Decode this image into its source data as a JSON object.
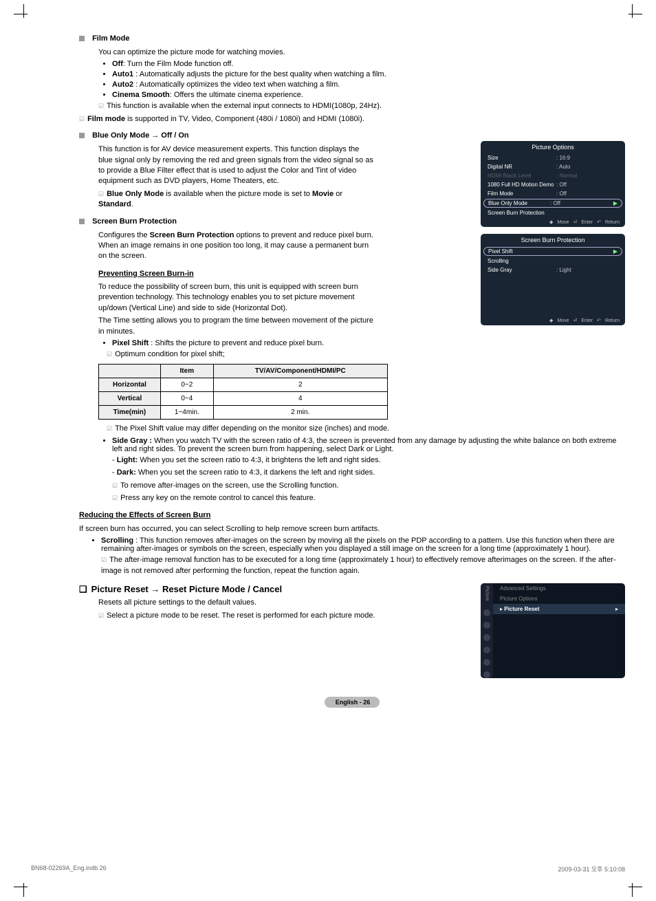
{
  "film_mode": {
    "title": "Film Mode",
    "desc": "You can optimize the picture mode for watching movies.",
    "off_label": "Off",
    "off_text": ": Turn the Film Mode function off.",
    "auto1_label": "Auto1",
    "auto1_text": " : Automatically adjusts the picture for the best quality when watching a film.",
    "auto2_label": "Auto2",
    "auto2_text": " : Automatically optimizes the video text when watching a film.",
    "cinema_label": "Cinema Smooth",
    "cinema_text": ": Offers the ultimate cinema experience.",
    "note1": "This function is available when the external input connects to HDMI(1080p, 24Hz).",
    "note2_a": "Film mode",
    "note2_b": " is supported in TV, Video, Component (480i / 1080i)  and HDMI (1080i)."
  },
  "blue_only": {
    "title": "Blue Only Mode → Off / On",
    "desc": "This function is for AV device measurement experts. This function displays the blue signal only by removing the red and green signals from the video signal so as to provide a Blue Filter effect that is used to adjust the Color and Tint of video equipment such as DVD players, Home Theaters, etc.",
    "note_a": "Blue Only Mode",
    "note_b": " is available when the picture mode is set to ",
    "note_c": "Movie",
    "note_d": " or ",
    "note_e": "Standard",
    "note_f": "."
  },
  "screen_burn": {
    "title": "Screen Burn Protection",
    "desc1": "Configures the ",
    "desc1b": "Screen Burn Protection",
    "desc1c": " options to prevent and reduce pixel burn. When an image remains in one position too long, it may cause a permanent burn on the screen.",
    "prevent_heading": "Preventing Screen Burn-in",
    "prevent_p1": "To reduce the possibility of screen burn, this unit is equipped with screen burn prevention technology. This technology enables you to set picture movement up/down (Vertical Line) and side to side (Horizontal Dot).",
    "prevent_p2": "The Time setting allows you to program the time between movement of the picture in minutes.",
    "pixel_shift_label": "Pixel Shift",
    "pixel_shift_text": " : Shifts the picture to prevent and reduce pixel burn.",
    "pixel_note": "Optimum condition for pixel shift;",
    "table": {
      "h1": "Item",
      "h2": "TV/AV/Component/HDMI/PC",
      "r1a": "Horizontal",
      "r1b": "0~2",
      "r1c": "2",
      "r2a": "Vertical",
      "r2b": "0~4",
      "r2c": "4",
      "r3a": "Time(min)",
      "r3b": "1~4min.",
      "r3c": "2 min."
    },
    "pixel_note2": "The Pixel Shift value may differ depending on the monitor size (inches) and mode.",
    "side_gray_label": "Side Gray :",
    "side_gray_text": " When you watch TV with the screen ratio of 4:3, the screen is prevented from any damage by adjusting the white balance on both extreme left and right sides. To prevent the screen burn from happening, select Dark or Light.",
    "light_label": "Light:",
    "light_text": " When you set the screen ratio to 4:3, it brightens the left and right sides.",
    "dark_label": "Dark:",
    "dark_text": " When you set the screen ratio to 4:3, it darkens the left and right sides.",
    "note3": "To remove after-images on the screen, use the Scrolling function.",
    "note4": "Press any key on the remote control to cancel this feature.",
    "reduce_heading": "Reducing the Effects of Screen Burn",
    "reduce_p": "If screen burn has occurred, you can select Scrolling to help remove screen burn artifacts.",
    "scroll_label": "Scrolling",
    "scroll_text": " : This function removes after-images on the screen by moving all the pixels on the PDP according to a pattern. Use this function when there are remaining after-images or symbols on the screen, especially when you displayed a still image on the screen for a long time (approximately 1 hour).",
    "scroll_note": "The after-image removal function has to be executed for a long time (approximately 1 hour) to effectively remove afterimages on the screen. If the after-image is not removed after performing the function, repeat the function again."
  },
  "picture_reset": {
    "title": "Picture Reset → Reset Picture Mode / Cancel",
    "desc": "Resets all picture settings to the default values.",
    "note": "Select a picture mode to be reset. The reset is performed for each picture mode."
  },
  "menu1": {
    "title": "Picture Options",
    "r1a": "Size",
    "r1b": ": 16:9",
    "r2a": "Digital NR",
    "r2b": ": Auto",
    "r3a": "HDMI Black Level",
    "r3b": ": Normal",
    "r4a": "1080 Full HD Motion Demo",
    "r4b": ": Off",
    "r5a": "Film Mode",
    "r5b": ": Off",
    "r6a": "Blue Only Mode",
    "r6b": ": Off",
    "r7a": "Screen Burn Protection",
    "f1": "Move",
    "f2": "Enter",
    "f3": "Return"
  },
  "menu2": {
    "title": "Screen Burn Protection",
    "r1a": "Pixel Shift",
    "r2a": "Scrolling",
    "r3a": "Side Gray",
    "r3b": ": Light",
    "f1": "Move",
    "f2": "Enter",
    "f3": "Return"
  },
  "menu3": {
    "side_label": "Picture",
    "r1": "Advanced Settings",
    "r2": "Picture Options",
    "r3": "Picture Reset"
  },
  "page": {
    "lang": "English - ",
    "num": "26",
    "doc": "BN68-02269A_Eng.indb   26",
    "date": "2009-03-31   오후 5:10:08"
  }
}
